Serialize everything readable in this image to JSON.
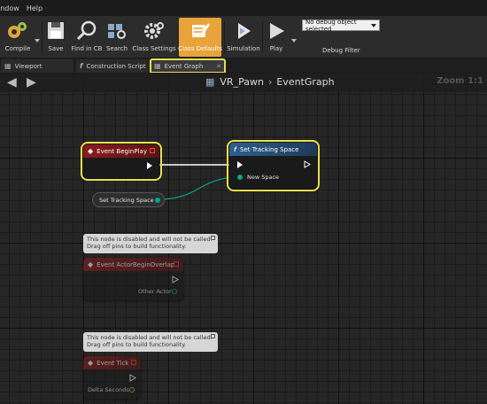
{
  "menu": [
    "indow",
    "Help"
  ],
  "toolbar": {
    "compile": "Compile",
    "save": "Save",
    "find_in_cb": "Find in CB",
    "search": "Search",
    "class_settings": "Class Settings",
    "class_defaults": "Class Defaults",
    "simulation": "Simulation",
    "play": "Play",
    "debug_selected": "No debug object selected",
    "debug_filter": "Debug Filter"
  },
  "tabs": {
    "viewport": "Viewport",
    "construction_script": "Construction Script",
    "event_graph": "Event Graph"
  },
  "graph": {
    "breadcrumb_root": "VR_Pawn",
    "breadcrumb_leaf": "EventGraph",
    "zoom": "Zoom 1:1"
  },
  "nodes": {
    "begin_play": "Event BeginPlay",
    "set_tracking_header": "Set Tracking Space",
    "new_space_pin": "New Space",
    "set_tracking_pill": "Set Tracking Space",
    "actor_begin_overlap": "Event ActorBeginOverlap",
    "other_actor_pin": "Other Actor",
    "event_tick": "Event Tick",
    "delta_seconds_pin": "Delta Seconds",
    "disabled_note_1": "This node is disabled and will not be called.",
    "disabled_note_2": "Drag off pins to build functionality."
  },
  "colors": {
    "event_header": "#8b1c1c",
    "function_header": "#2d5f8f",
    "accent": "#e8a33a",
    "selection": "#e8df4f",
    "data_pin": "#00a88a"
  }
}
